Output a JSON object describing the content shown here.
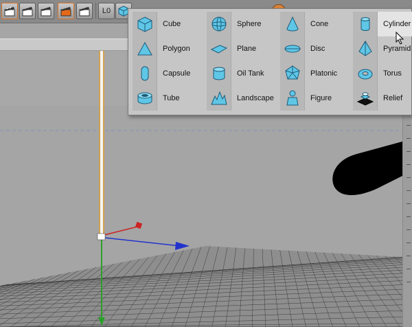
{
  "toolbar": {
    "buttons": [
      {
        "icon": "clapper-render-view-icon",
        "selected": true
      },
      {
        "icon": "clapper-render-picture-icon",
        "selected": false
      },
      {
        "icon": "clapper-render-settings-icon",
        "selected": false
      },
      {
        "icon": "clapper-render-region-icon",
        "selected": true
      },
      {
        "icon": "clapper-edit-render-icon",
        "selected": false
      },
      {
        "icon": "null-object-icon",
        "selected": false
      },
      {
        "icon": "cube-primitive-icon",
        "selected": false
      }
    ],
    "null_label": "0"
  },
  "palette": {
    "columns": [
      [
        {
          "label": "Cube",
          "icon": "cube-icon"
        },
        {
          "label": "Polygon",
          "icon": "polygon-icon"
        },
        {
          "label": "Capsule",
          "icon": "capsule-icon"
        },
        {
          "label": "Tube",
          "icon": "tube-icon"
        }
      ],
      [
        {
          "label": "Sphere",
          "icon": "sphere-icon"
        },
        {
          "label": "Plane",
          "icon": "plane-icon"
        },
        {
          "label": "Oil Tank",
          "icon": "oil-tank-icon"
        },
        {
          "label": "Landscape",
          "icon": "landscape-icon"
        }
      ],
      [
        {
          "label": "Cone",
          "icon": "cone-icon"
        },
        {
          "label": "Disc",
          "icon": "disc-icon"
        },
        {
          "label": "Platonic",
          "icon": "platonic-icon"
        },
        {
          "label": "Figure",
          "icon": "figure-icon"
        }
      ],
      [
        {
          "label": "Cylinder",
          "icon": "cylinder-icon",
          "hover": true
        },
        {
          "label": "Pyramid",
          "icon": "pyramid-icon"
        },
        {
          "label": "Torus",
          "icon": "torus-icon"
        },
        {
          "label": "Relief",
          "icon": "relief-icon"
        }
      ]
    ]
  },
  "colors": {
    "icon_fill": "#5fc6e6",
    "icon_stroke": "#1c5a78",
    "axis_x": "#2233cc",
    "axis_y": "#2aa02a",
    "axis_z": "#cc2222",
    "selection": "#e0a030",
    "grid": "#3a3a3a"
  }
}
